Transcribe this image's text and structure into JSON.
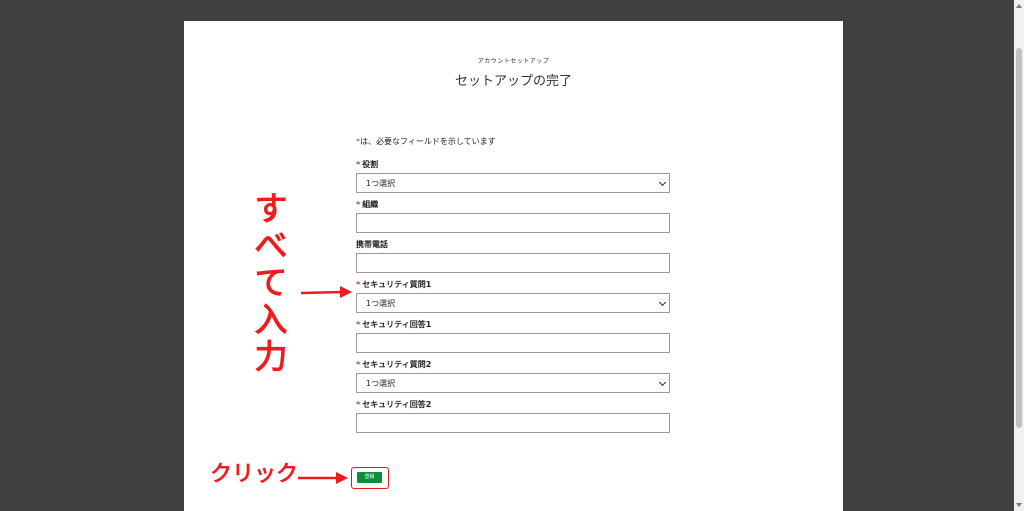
{
  "header": {
    "eyebrow": "アカウントセットアップ",
    "title": "セットアップの完了"
  },
  "form": {
    "required_mark": "*",
    "required_note": "は、必要なフィールドを示しています",
    "fields": [
      {
        "label": "役割",
        "required": true,
        "type": "select",
        "value": "1つ選択"
      },
      {
        "label": "組織",
        "required": true,
        "type": "text",
        "value": ""
      },
      {
        "label": "携帯電話",
        "required": false,
        "type": "text",
        "value": ""
      },
      {
        "label": "セキュリティ質問1",
        "required": true,
        "type": "select",
        "value": "1つ選択"
      },
      {
        "label": "セキュリティ回答1",
        "required": true,
        "type": "text",
        "value": ""
      },
      {
        "label": "セキュリティ質問2",
        "required": true,
        "type": "select",
        "value": "1つ選択"
      },
      {
        "label": "セキュリティ回答2",
        "required": true,
        "type": "text",
        "value": ""
      }
    ],
    "submit_label": "登録"
  },
  "annotations": {
    "fill_all": [
      "す",
      "べ",
      "て",
      "入",
      "力"
    ],
    "click": "クリック",
    "color": "#ee1c1c"
  },
  "colors": {
    "background": "#404040",
    "submit": "#0c8f3b",
    "required": "#c23934"
  }
}
